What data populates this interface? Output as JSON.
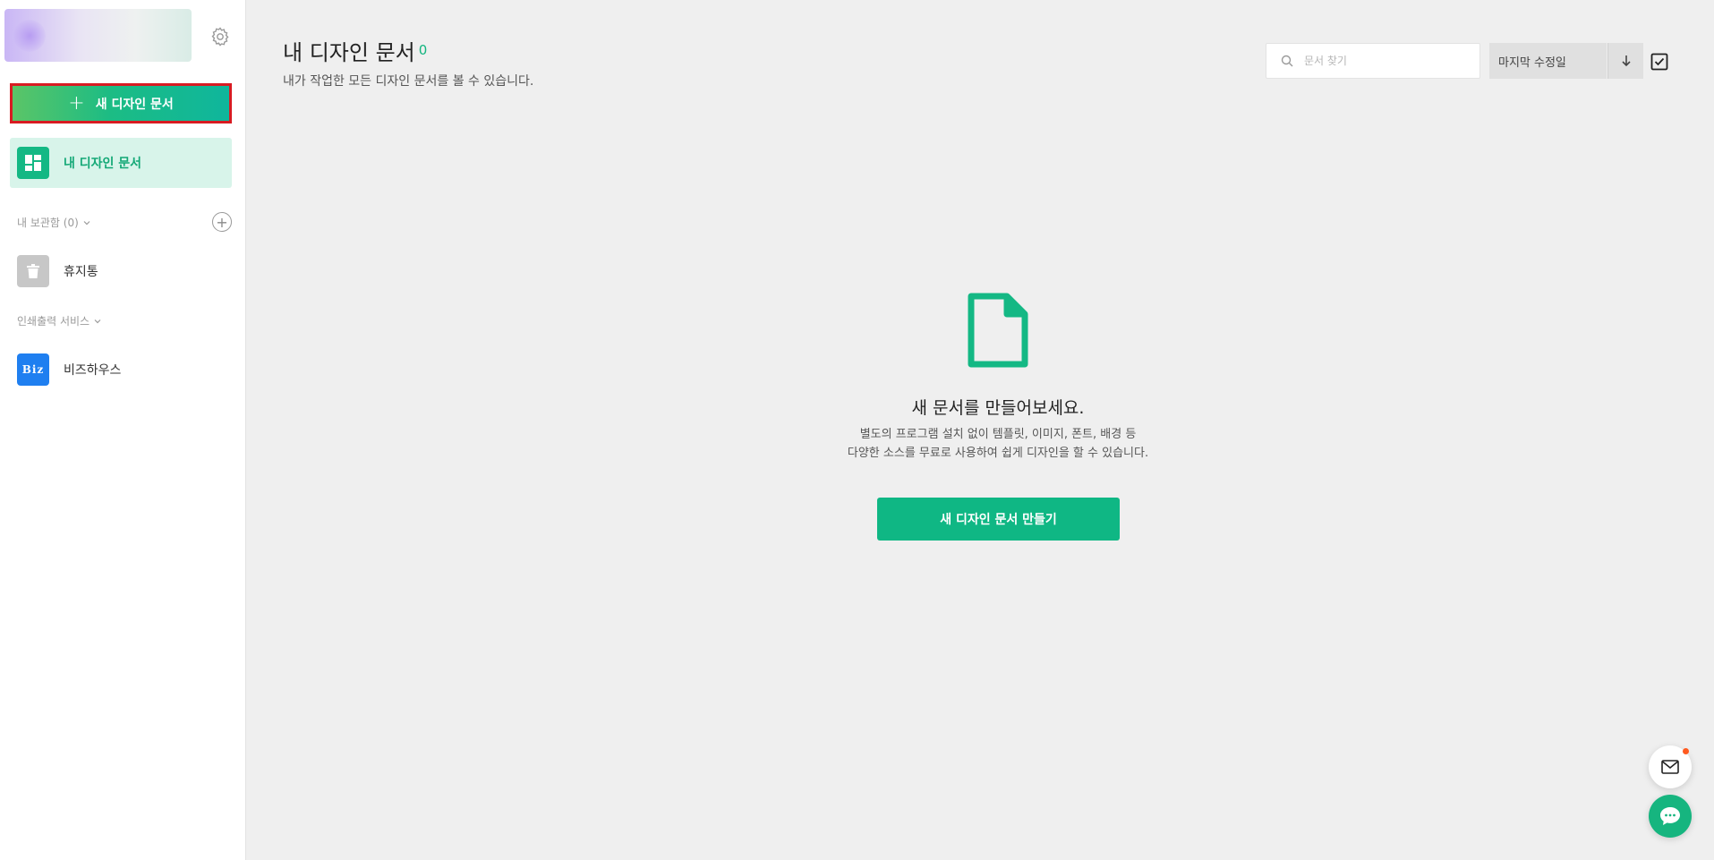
{
  "sidebar": {
    "new_button_label": "새 디자인 문서",
    "active_item_label": "내 디자인 문서",
    "storage_section_label": "내 보관함 (0)",
    "trash_label": "휴지통",
    "print_section_label": "인쇄출력 서비스",
    "bizhouse_label": "비즈하우스",
    "bizhouse_icon_text": "Biz"
  },
  "header": {
    "title": "내 디자인 문서",
    "count": "0",
    "subtitle": "내가 작업한 모든 디자인 문서를 볼 수 있습니다."
  },
  "toolbar": {
    "search_placeholder": "문서 찾기",
    "sort_label": "마지막 수정일"
  },
  "empty_state": {
    "title": "새 문서를 만들어보세요.",
    "desc_line1": "별도의 프로그램 설치 없이 템플릿, 이미지, 폰트, 배경 등",
    "desc_line2": "다양한 소스를 무료로 사용하여 쉽게 디자인을 할 수 있습니다.",
    "button_label": "새 디자인 문서 만들기"
  },
  "colors": {
    "brand_green": "#0fb784",
    "highlight_red": "#d81b22",
    "active_bg": "#d8f4ea"
  }
}
